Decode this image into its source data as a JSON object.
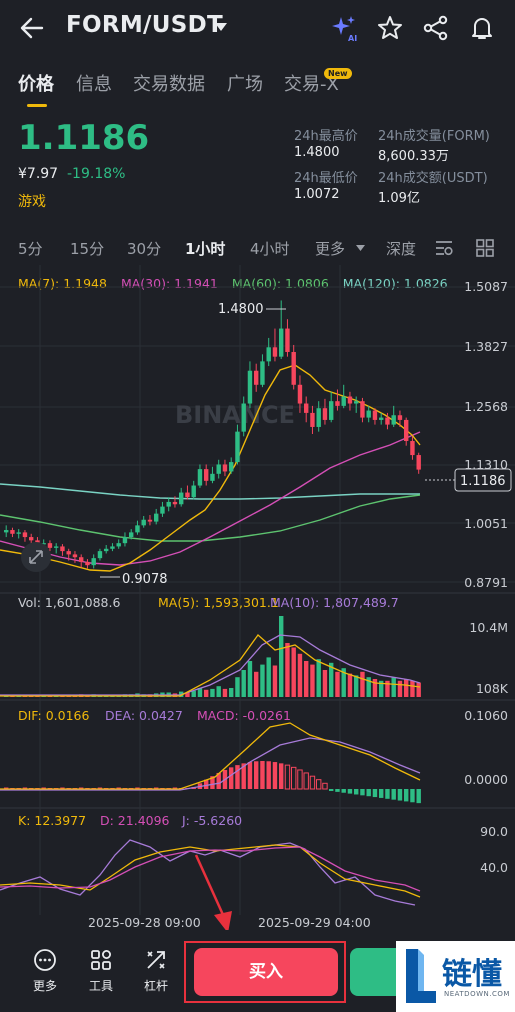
{
  "header": {
    "pair": "FORM/USDT",
    "icons": [
      "back-icon",
      "caret-down-icon",
      "ai-sparkle-icon",
      "star-icon",
      "share-icon",
      "bell-icon"
    ]
  },
  "tabs": [
    {
      "label": "价格",
      "active": true
    },
    {
      "label": "信息"
    },
    {
      "label": "交易数据"
    },
    {
      "label": "广场"
    },
    {
      "label": "交易-X",
      "badge": "New"
    }
  ],
  "price": {
    "last": "1.1186",
    "cny": "¥7.97",
    "change": "-19.18%",
    "tag": "游戏"
  },
  "stats": [
    {
      "label": "24h最高价",
      "value": "1.4800"
    },
    {
      "label": "24h成交量(FORM)",
      "value": "8,600.33万"
    },
    {
      "label": "24h最低价",
      "value": "1.0072"
    },
    {
      "label": "24h成交额(USDT)",
      "value": "1.09亿"
    }
  ],
  "intervals": [
    {
      "label": "5分"
    },
    {
      "label": "15分"
    },
    {
      "label": "30分"
    },
    {
      "label": "1小时",
      "active": true
    },
    {
      "label": "4小时"
    },
    {
      "label": "更多"
    },
    {
      "label": "深度"
    }
  ],
  "ma_legend": {
    "ma7": "MA(7): 1.1948",
    "ma30": "MA(30): 1.1941",
    "ma60": "MA(60): 1.0806",
    "ma120": "MA(120): 1.0826"
  },
  "colors": {
    "up": "#2ebd85",
    "down": "#f6465d",
    "ma7": "#f0b90b",
    "ma30": "#d44fb6",
    "ma60": "#5dc36f",
    "ma120": "#7ad3c4",
    "accent": "#f0b90b"
  },
  "chart_data": {
    "type": "candlestick",
    "price_axis_labels": [
      "1.5087",
      "1.3827",
      "1.2568",
      "1.1310",
      "1.0051",
      "0.8791"
    ],
    "ylim": [
      0.8791,
      1.5087
    ],
    "current_price": "1.1186",
    "high_label": "1.4800",
    "low_label": "0.9078",
    "x_labels": [
      "2025-09-28 09:00",
      "2025-09-29 04:00"
    ],
    "watermark": "BINANCE",
    "volume": {
      "legend": "Vol: 1,601,088.6",
      "ma5": "MA(5): 1,593,301.1",
      "ma10": "MA(10): 1,807,489.7",
      "axis_labels": [
        "10.4M",
        "108K"
      ]
    },
    "macd": {
      "dif": "DIF: 0.0166",
      "dea": "DEA: 0.0427",
      "macd": "MACD: -0.0261",
      "axis_labels": [
        "0.1060",
        "0.0000"
      ]
    },
    "kdj": {
      "k": "K: 12.3977",
      "d": "D: 21.4096",
      "j": "J: -5.6260",
      "axis_labels": [
        "90.0",
        "40.0"
      ]
    }
  },
  "bottom": {
    "more": "更多",
    "tools": "工具",
    "leverage": "杠杆",
    "buy": "买入"
  },
  "logo": {
    "cn": "链懂",
    "en": "NEATDOWN.COM"
  }
}
